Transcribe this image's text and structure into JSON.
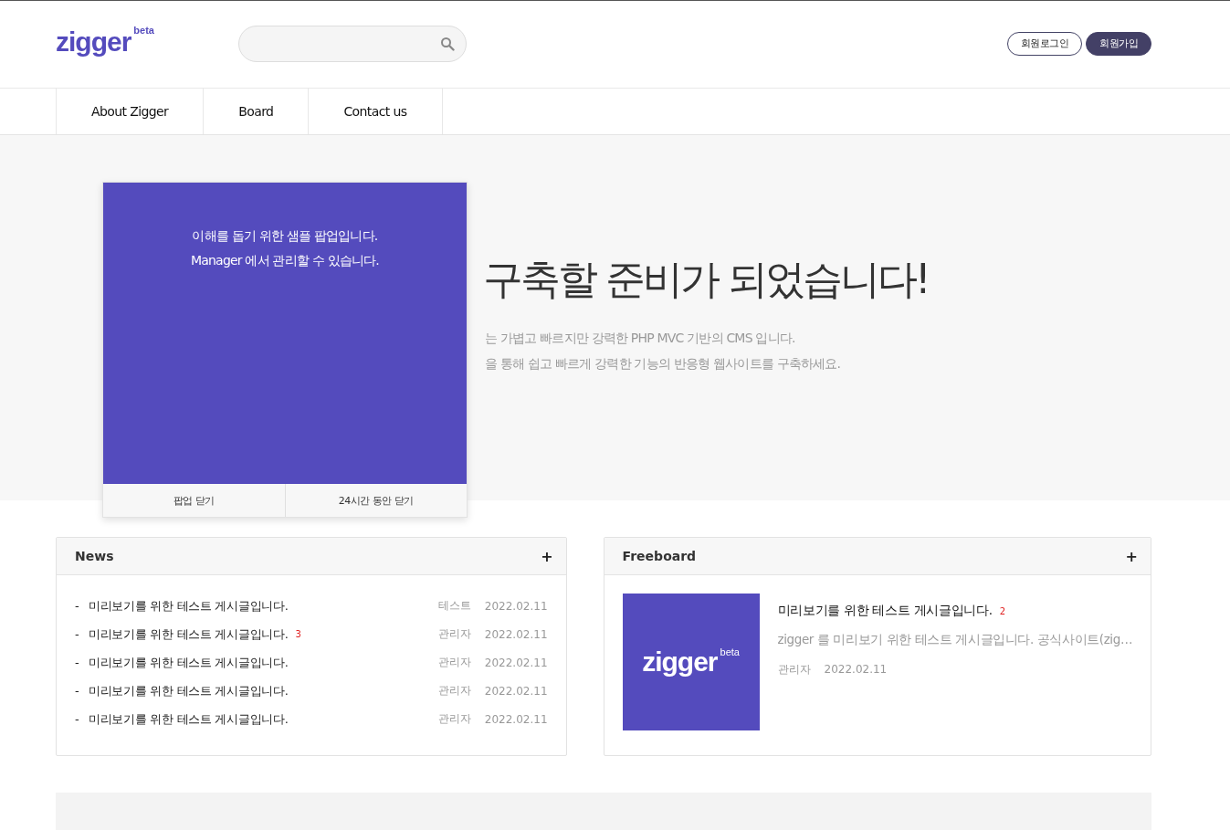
{
  "header": {
    "logo": "zigger",
    "logo_sup": "beta",
    "buttons": [
      {
        "label": "회원로그인",
        "kind": "outline"
      },
      {
        "label": "회원가입",
        "kind": "filled"
      }
    ]
  },
  "nav": [
    "About Zigger",
    "Board",
    "Contact us"
  ],
  "hero": {
    "title": "구축할 준비가 되었습니다!",
    "lines": [
      "는 가볍고 빠르지만 강력한 PHP MVC 기반의 CMS 입니다.",
      "을 통해 쉽고 빠르게 강력한 기능의 반응형 웹사이트를 구축하세요."
    ]
  },
  "popup": {
    "lines": [
      "이해를 돕기 위한 샘플 팝업입니다.",
      "Manager 에서 관리할 수 있습니다."
    ],
    "buttons": [
      "팝업 닫기",
      "24시간 동안 닫기"
    ]
  },
  "news": {
    "title": "News",
    "more": "+",
    "rows": [
      {
        "bullet": "-",
        "title": "미리보기를 위한 테스트 게시글입니다.",
        "author": "테스트",
        "date": "2022.02.11"
      },
      {
        "bullet": "-",
        "title": "미리보기를 위한 테스트 게시글입니다.",
        "comments": "3",
        "author": "관리자",
        "date": "2022.02.11"
      },
      {
        "bullet": "-",
        "title": "미리보기를 위한 테스트 게시글입니다.",
        "author": "관리자",
        "date": "2022.02.11"
      },
      {
        "bullet": "-",
        "title": "미리보기를 위한 테스트 게시글입니다.",
        "author": "관리자",
        "date": "2022.02.11"
      },
      {
        "bullet": "-",
        "title": "미리보기를 위한 테스트 게시글입니다.",
        "author": "관리자",
        "date": "2022.02.11"
      }
    ]
  },
  "freeboard": {
    "title": "Freeboard",
    "more": "+",
    "post": {
      "thumb_logo": "zigger",
      "thumb_sup": "beta",
      "title": "미리보기를 위한 테스트 게시글입니다.",
      "comments": "2",
      "excerpt": "zigger 를 미리보기 위한 테스트 게시글입니다. 공식사이트(zig…",
      "author": "관리자",
      "date": "2022.02.11"
    }
  }
}
